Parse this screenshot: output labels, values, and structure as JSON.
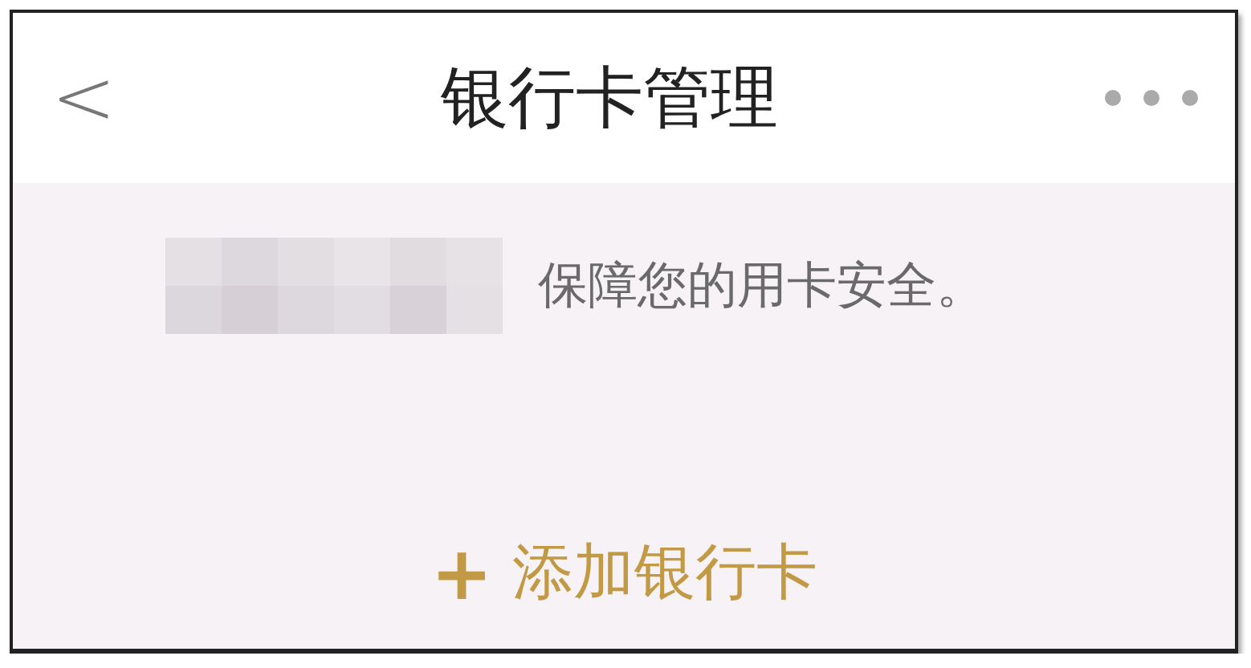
{
  "header": {
    "back": "<",
    "title": "银行卡管理"
  },
  "notice": {
    "text": "保障您的用卡安全。"
  },
  "add_card": {
    "icon": "+",
    "label": "添加银行卡"
  }
}
